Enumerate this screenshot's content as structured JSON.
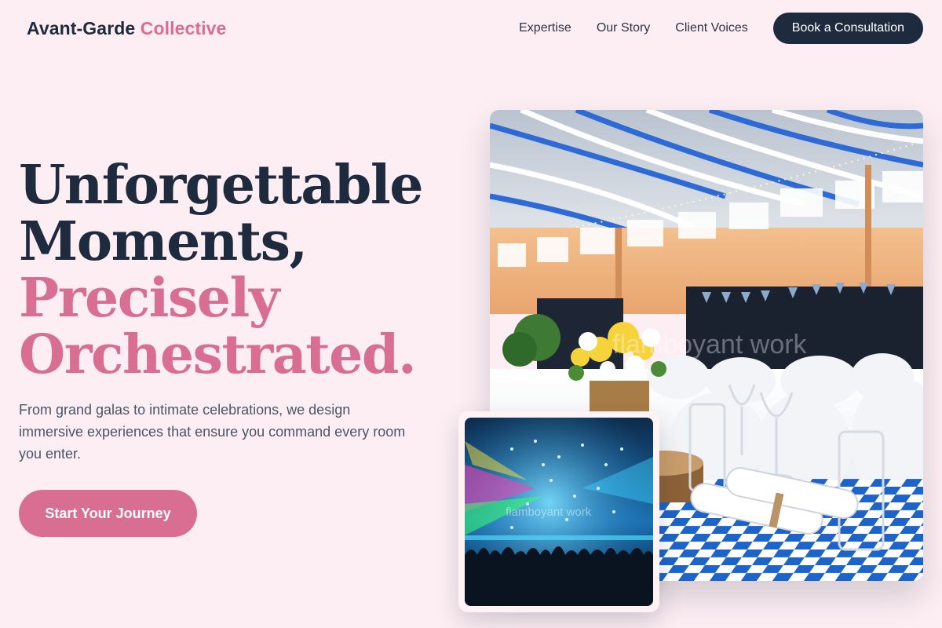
{
  "brand": {
    "name_main": "Avant-Garde",
    "name_accent": "Collective"
  },
  "nav": {
    "links": [
      "Expertise",
      "Our Story",
      "Client Voices"
    ],
    "cta_label": "Book a Consultation"
  },
  "hero": {
    "title_lines": [
      "Unforgettable",
      "Moments,"
    ],
    "title_accent_lines": [
      "Precisely",
      "Orchestrated."
    ],
    "description": "From grand galas to intimate celebrations, we design immersive experiences that ensure you command every room you enter.",
    "cta_label": "Start Your Journey"
  },
  "images": {
    "main_watermark": "flamboyant work",
    "inset_watermark": "flamboyant work"
  },
  "colors": {
    "background": "#fdeef3",
    "navy": "#1e2a3d",
    "accent_pink": "#d96e93"
  }
}
